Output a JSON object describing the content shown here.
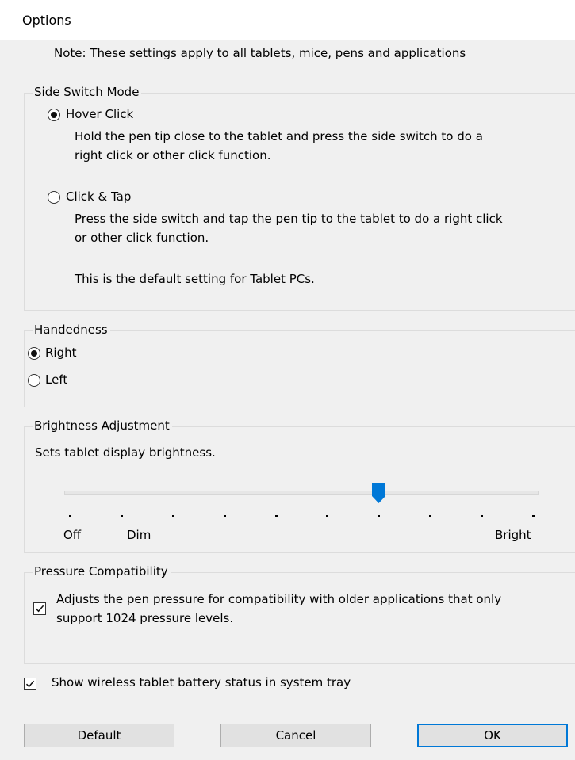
{
  "window": {
    "title": "Options"
  },
  "note": "Note: These settings apply to all tablets, mice, pens and applications",
  "side_switch": {
    "legend": "Side Switch Mode",
    "hover_label": "Hover Click",
    "hover_desc_1": "Hold the pen tip close to the tablet and press the side switch to do a",
    "hover_desc_2": "right click or other click function.",
    "click_label": "Click & Tap",
    "click_desc_1": "Press the side switch and tap the pen tip to the tablet to do a right click",
    "click_desc_2": "or other click function.",
    "click_desc_3": "This is the default setting for Tablet PCs.",
    "selected": "Hover Click"
  },
  "handedness": {
    "legend": "Handedness",
    "right_label": "Right",
    "left_label": "Left",
    "selected": "Right"
  },
  "brightness": {
    "legend": "Brightness Adjustment",
    "desc": "Sets tablet display brightness.",
    "labels": {
      "off": "Off",
      "dim": "Dim",
      "bright": "Bright"
    },
    "tick_count": 10,
    "value_index": 6,
    "thumb_color": "#0078d7"
  },
  "pressure": {
    "legend": "Pressure Compatibility",
    "desc_1": "Adjusts the pen pressure for compatibility with older applications that only",
    "desc_2": "support 1024 pressure levels.",
    "checked": true
  },
  "battery": {
    "label": "Show wireless tablet battery status in system tray",
    "checked": true
  },
  "buttons": {
    "default": "Default",
    "cancel": "Cancel",
    "ok": "OK"
  }
}
